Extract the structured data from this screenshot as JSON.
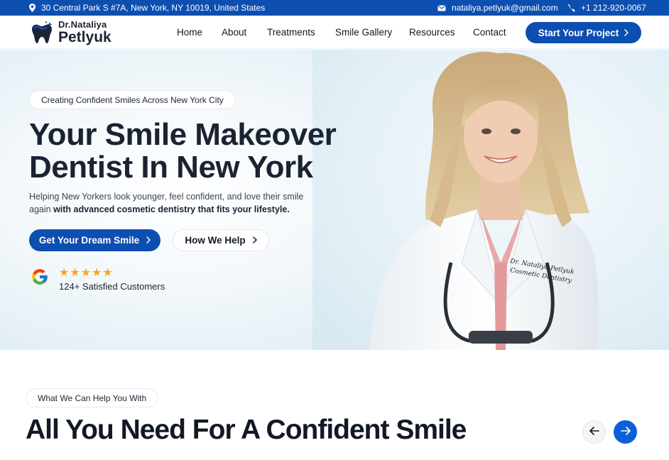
{
  "topbar": {
    "address": "30 Central Park S #7A, New York, NY 10019, United States",
    "email": "nataliya.petlyuk@gmail.com",
    "phone": "+1 212-920-0067"
  },
  "logo": {
    "line1": "Dr.Nataliya",
    "line2": "Petlyuk"
  },
  "nav": [
    {
      "label": "Home"
    },
    {
      "label": "About"
    },
    {
      "label": "Treatments"
    },
    {
      "label": "Smile Gallery"
    },
    {
      "label": "Resources"
    },
    {
      "label": "Contact"
    }
  ],
  "header_cta": "Start Your Project",
  "hero": {
    "badge": "Creating Confident Smiles Across New York City",
    "title_line1": "Your Smile Makeover",
    "title_line2": "Dentist In New York",
    "subtitle_plain": "Helping New Yorkers look younger, feel confident, and love their smile again",
    "subtitle_bold": "with advanced cosmetic dentistry that fits your lifestyle.",
    "primary_button": "Get Your Dream Smile",
    "secondary_button": "How We Help",
    "rating_stars": 5,
    "review_text": "124+ Satisfied Customers",
    "coat_embroidery_line1": "Dr. Nataliya Petlyuk",
    "coat_embroidery_line2": "Cosmetic Dentistry"
  },
  "section": {
    "badge": "What We Can Help You With",
    "title": "All You Need For A Confident Smile"
  },
  "colors": {
    "brand_blue": "#0d4fb0",
    "accent_blue": "#0d5fd8",
    "star": "#f5a623",
    "heading": "#1b2333"
  },
  "icons": [
    "location-pin-icon",
    "mail-icon",
    "phone-icon",
    "chevron-right-icon",
    "google-icon",
    "star-icon",
    "arrow-left-icon",
    "arrow-right-icon",
    "tooth-logo-icon"
  ]
}
